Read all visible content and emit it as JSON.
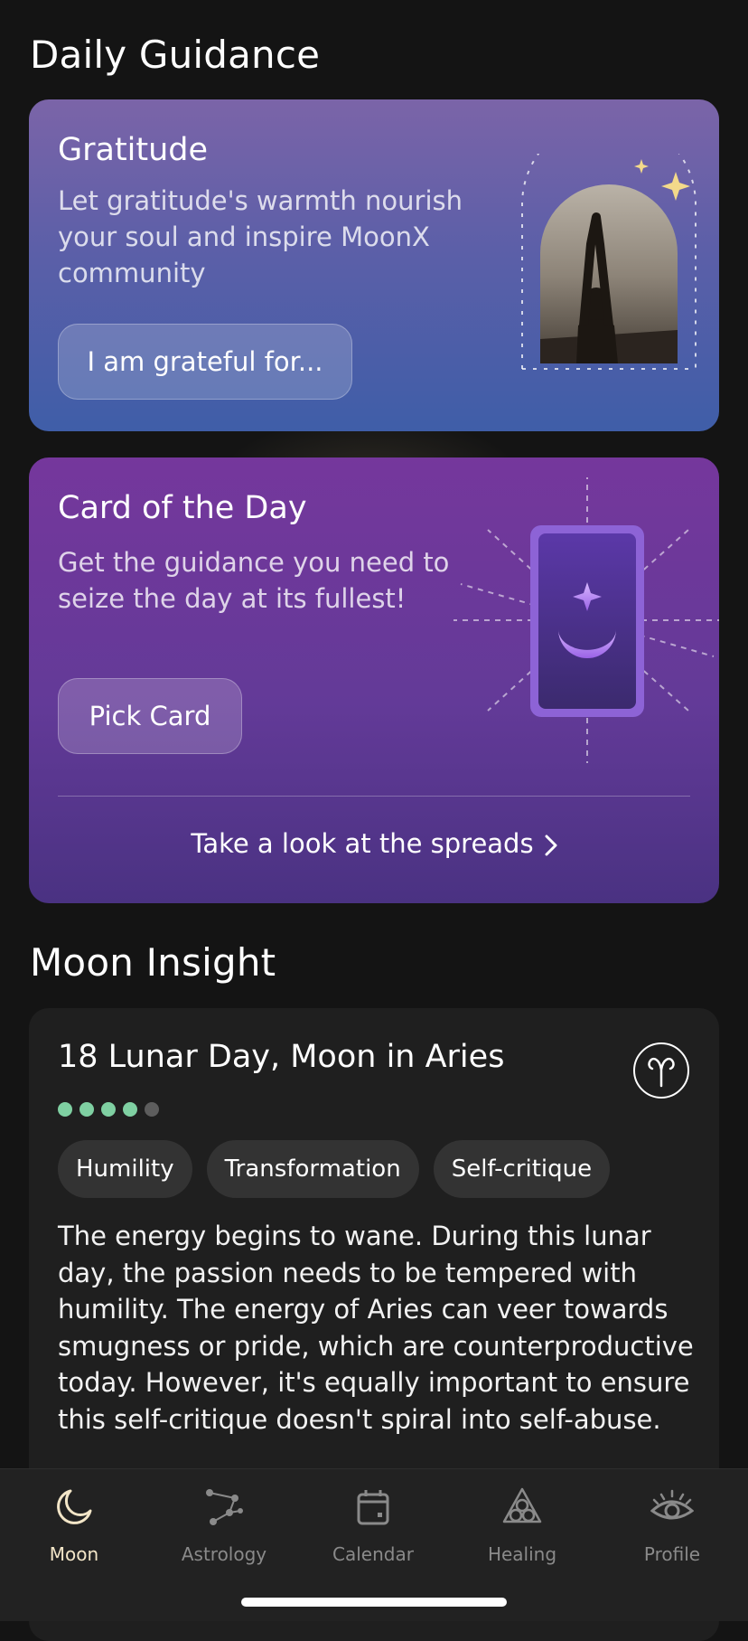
{
  "daily_guidance": {
    "section_title": "Daily Guidance",
    "gratitude": {
      "title": "Gratitude",
      "description": "Let gratitude's warmth nourish your soul and inspire MoonX community",
      "button_label": "I am grateful for..."
    },
    "card_of_day": {
      "title": "Card of the Day",
      "description": "Get the guidance you need to seize the day at its fullest!",
      "button_label": "Pick Card",
      "spreads_link": "Take a look at the spreads"
    }
  },
  "moon_insight": {
    "section_title": "Moon Insight",
    "title": "18 Lunar Day, Moon in Aries",
    "zodiac_icon": "aries-icon",
    "rating": {
      "value": 4,
      "max": 5,
      "color_on": "#7fd0a2",
      "color_off": "#5d5d5d"
    },
    "tags": [
      "Humility",
      "Transformation",
      "Self-critique"
    ],
    "text": "The energy begins to wane. During this lunar day, the passion needs to be tempered with humility. The energy of Aries can veer towards smugness or pride, which are counterproductive today. However, it's equally important to ensure this self-critique doesn't spiral into self-abuse."
  },
  "tab_bar": {
    "active": "Moon",
    "tabs": [
      {
        "label": "Moon",
        "icon": "moon-icon"
      },
      {
        "label": "Astrology",
        "icon": "constellation-icon"
      },
      {
        "label": "Calendar",
        "icon": "calendar-icon"
      },
      {
        "label": "Healing",
        "icon": "healing-icon"
      },
      {
        "label": "Profile",
        "icon": "eye-icon"
      }
    ]
  },
  "colors": {
    "background": "#141414",
    "gratitude_gradient": [
      "#7b64a8",
      "#3f5ea8"
    ],
    "card_day_gradient": [
      "#75379c",
      "#4a3282"
    ],
    "active_tab": "#f3e6c8",
    "inactive_tab": "#8a8a8a"
  }
}
